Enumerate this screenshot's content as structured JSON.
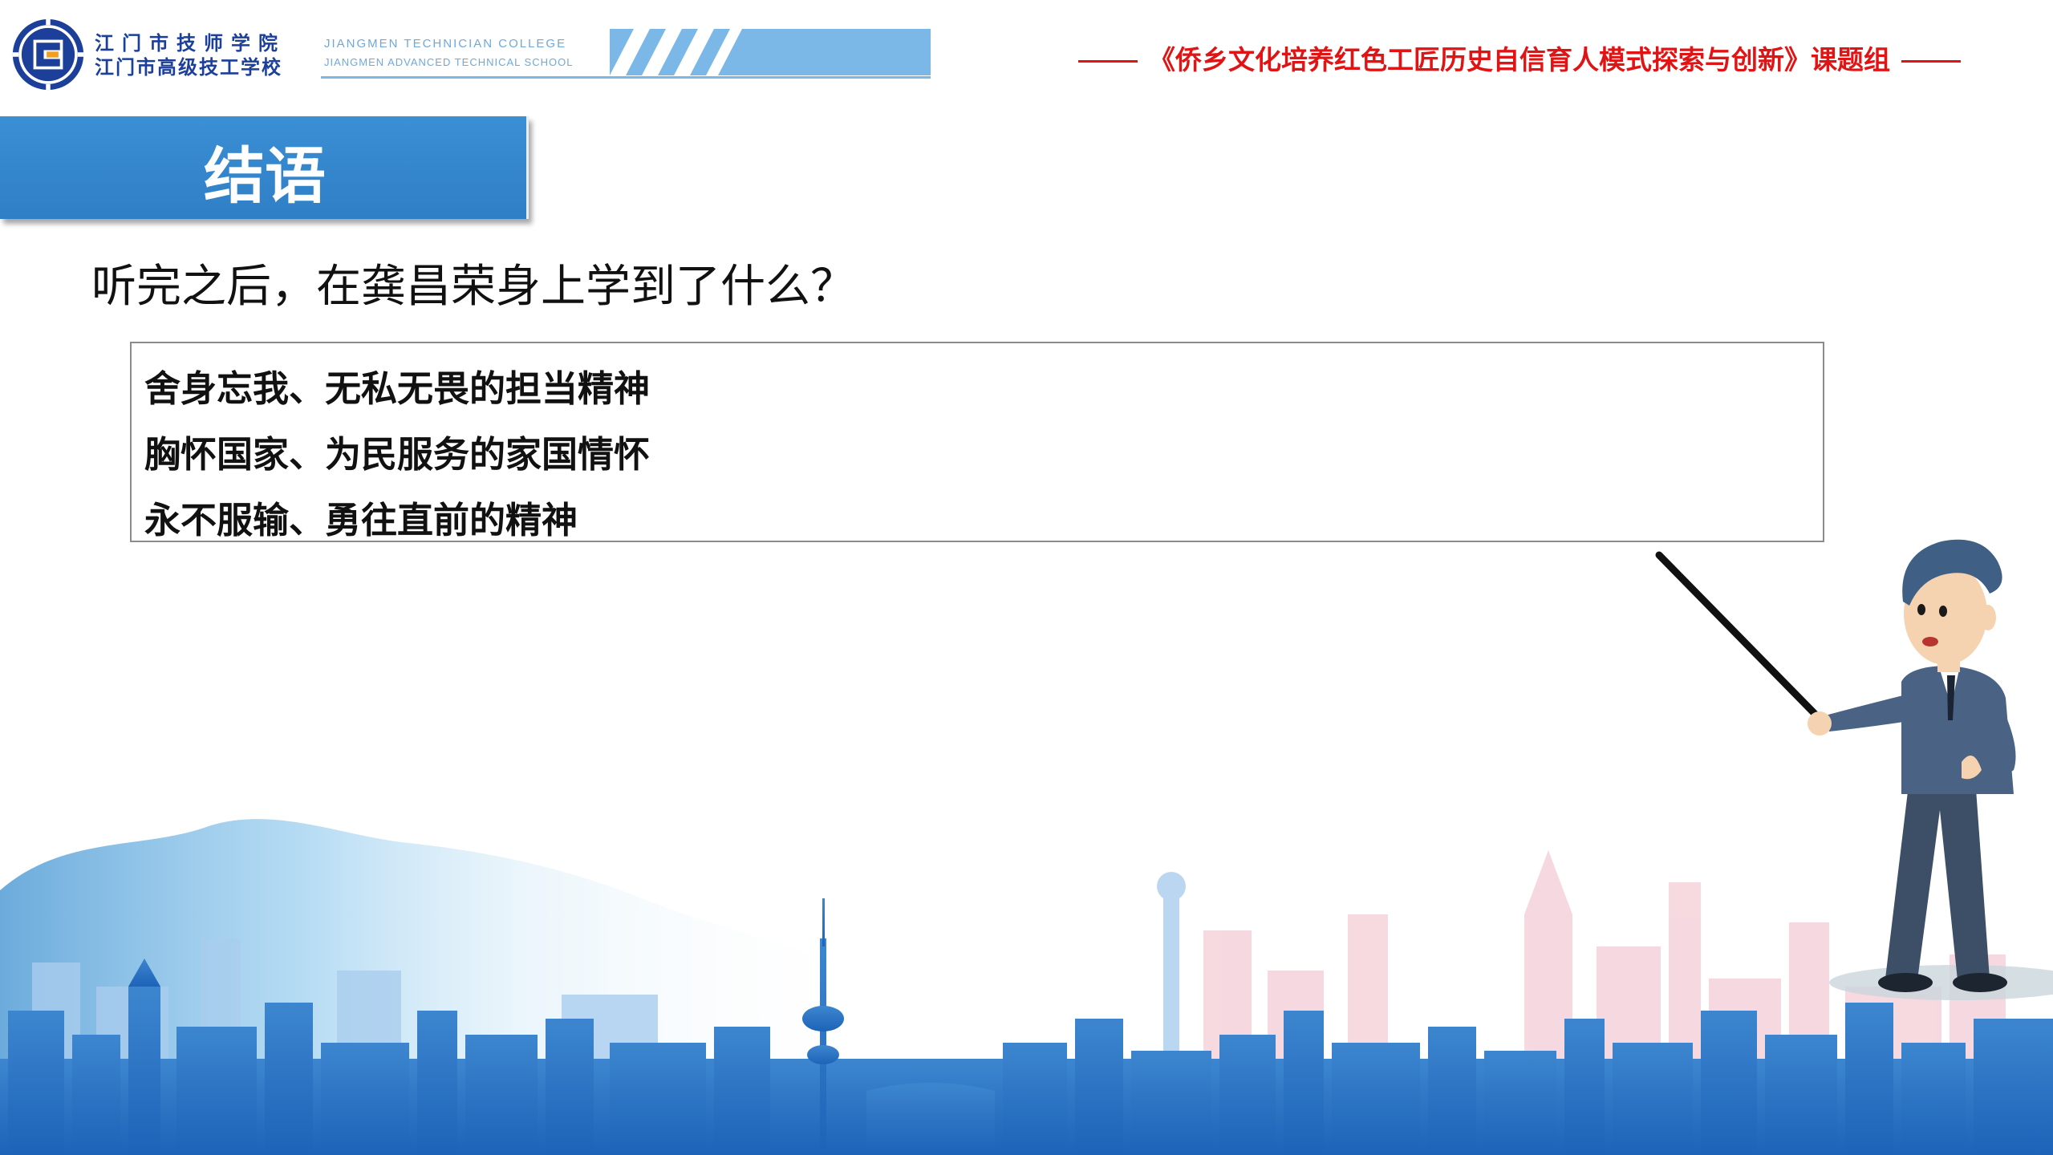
{
  "header": {
    "school_name_cn_1": "江门市技师学院",
    "school_name_cn_2": "江门市高级技工学校",
    "school_name_en_1": "JIANGMEN TECHNICIAN COLLEGE",
    "school_name_en_2": "JIANGMEN ADVANCED TECHNICAL SCHOOL",
    "project_title": "《侨乡文化培养红色工匠历史自信育人模式探索与创新》课题组"
  },
  "section": {
    "title": "结语"
  },
  "question": "听完之后，在龚昌荣身上学到了什么？",
  "answers": [
    "舍身忘我、无私无畏的担当精神",
    "胸怀国家、为民服务的家国情怀",
    "永不服输、勇往直前的精神"
  ],
  "colors": {
    "accent_blue": "#2f7fc6",
    "title_red": "#e01414",
    "header_light_blue": "#7bb8e8",
    "school_navy": "#1c3f9a"
  },
  "icons": [
    "school-logo-icon",
    "teacher-with-pointer-illustration",
    "city-skyline-illustration"
  ]
}
